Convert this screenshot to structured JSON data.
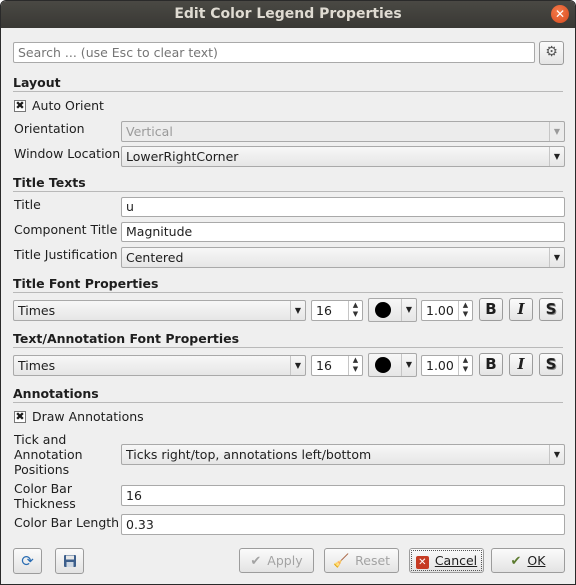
{
  "window": {
    "title": "Edit Color Legend Properties"
  },
  "search": {
    "placeholder": "Search ... (use Esc to clear text)"
  },
  "layout": {
    "heading": "Layout",
    "auto_orient": {
      "label": "Auto Orient",
      "checked": true
    },
    "orientation": {
      "label": "Orientation",
      "value": "Vertical"
    },
    "window_location": {
      "label": "Window Location",
      "value": "LowerRightCorner"
    }
  },
  "title_texts": {
    "heading": "Title Texts",
    "title": {
      "label": "Title",
      "value": "u"
    },
    "component_title": {
      "label": "Component Title",
      "value": "Magnitude"
    },
    "title_justification": {
      "label": "Title Justification",
      "value": "Centered"
    }
  },
  "title_font": {
    "heading": "Title Font Properties",
    "family": "Times",
    "size": "16",
    "opacity": "1.00",
    "bold": "B",
    "italic": "I",
    "shadow": "S"
  },
  "text_font": {
    "heading": "Text/Annotation Font Properties",
    "family": "Times",
    "size": "16",
    "opacity": "1.00",
    "bold": "B",
    "italic": "I",
    "shadow": "S"
  },
  "annotations": {
    "heading": "Annotations",
    "draw": {
      "label": "Draw Annotations",
      "checked": true
    },
    "positions": {
      "label_line1": "Tick and",
      "label_line2": "Annotation",
      "label_line3": "Positions",
      "value": "Ticks right/top, annotations left/bottom"
    },
    "thickness": {
      "label_line1": "Color Bar",
      "label_line2": "Thickness",
      "value": "16"
    },
    "length": {
      "label": "Color Bar Length",
      "value": "0.33"
    }
  },
  "buttons": {
    "apply": "Apply",
    "reset": "Reset",
    "cancel": "Cancel",
    "ok": "OK"
  },
  "colors": {
    "titlebar": "#3d3c38",
    "close": "#e4572a",
    "accent": "#5b7a2e"
  }
}
